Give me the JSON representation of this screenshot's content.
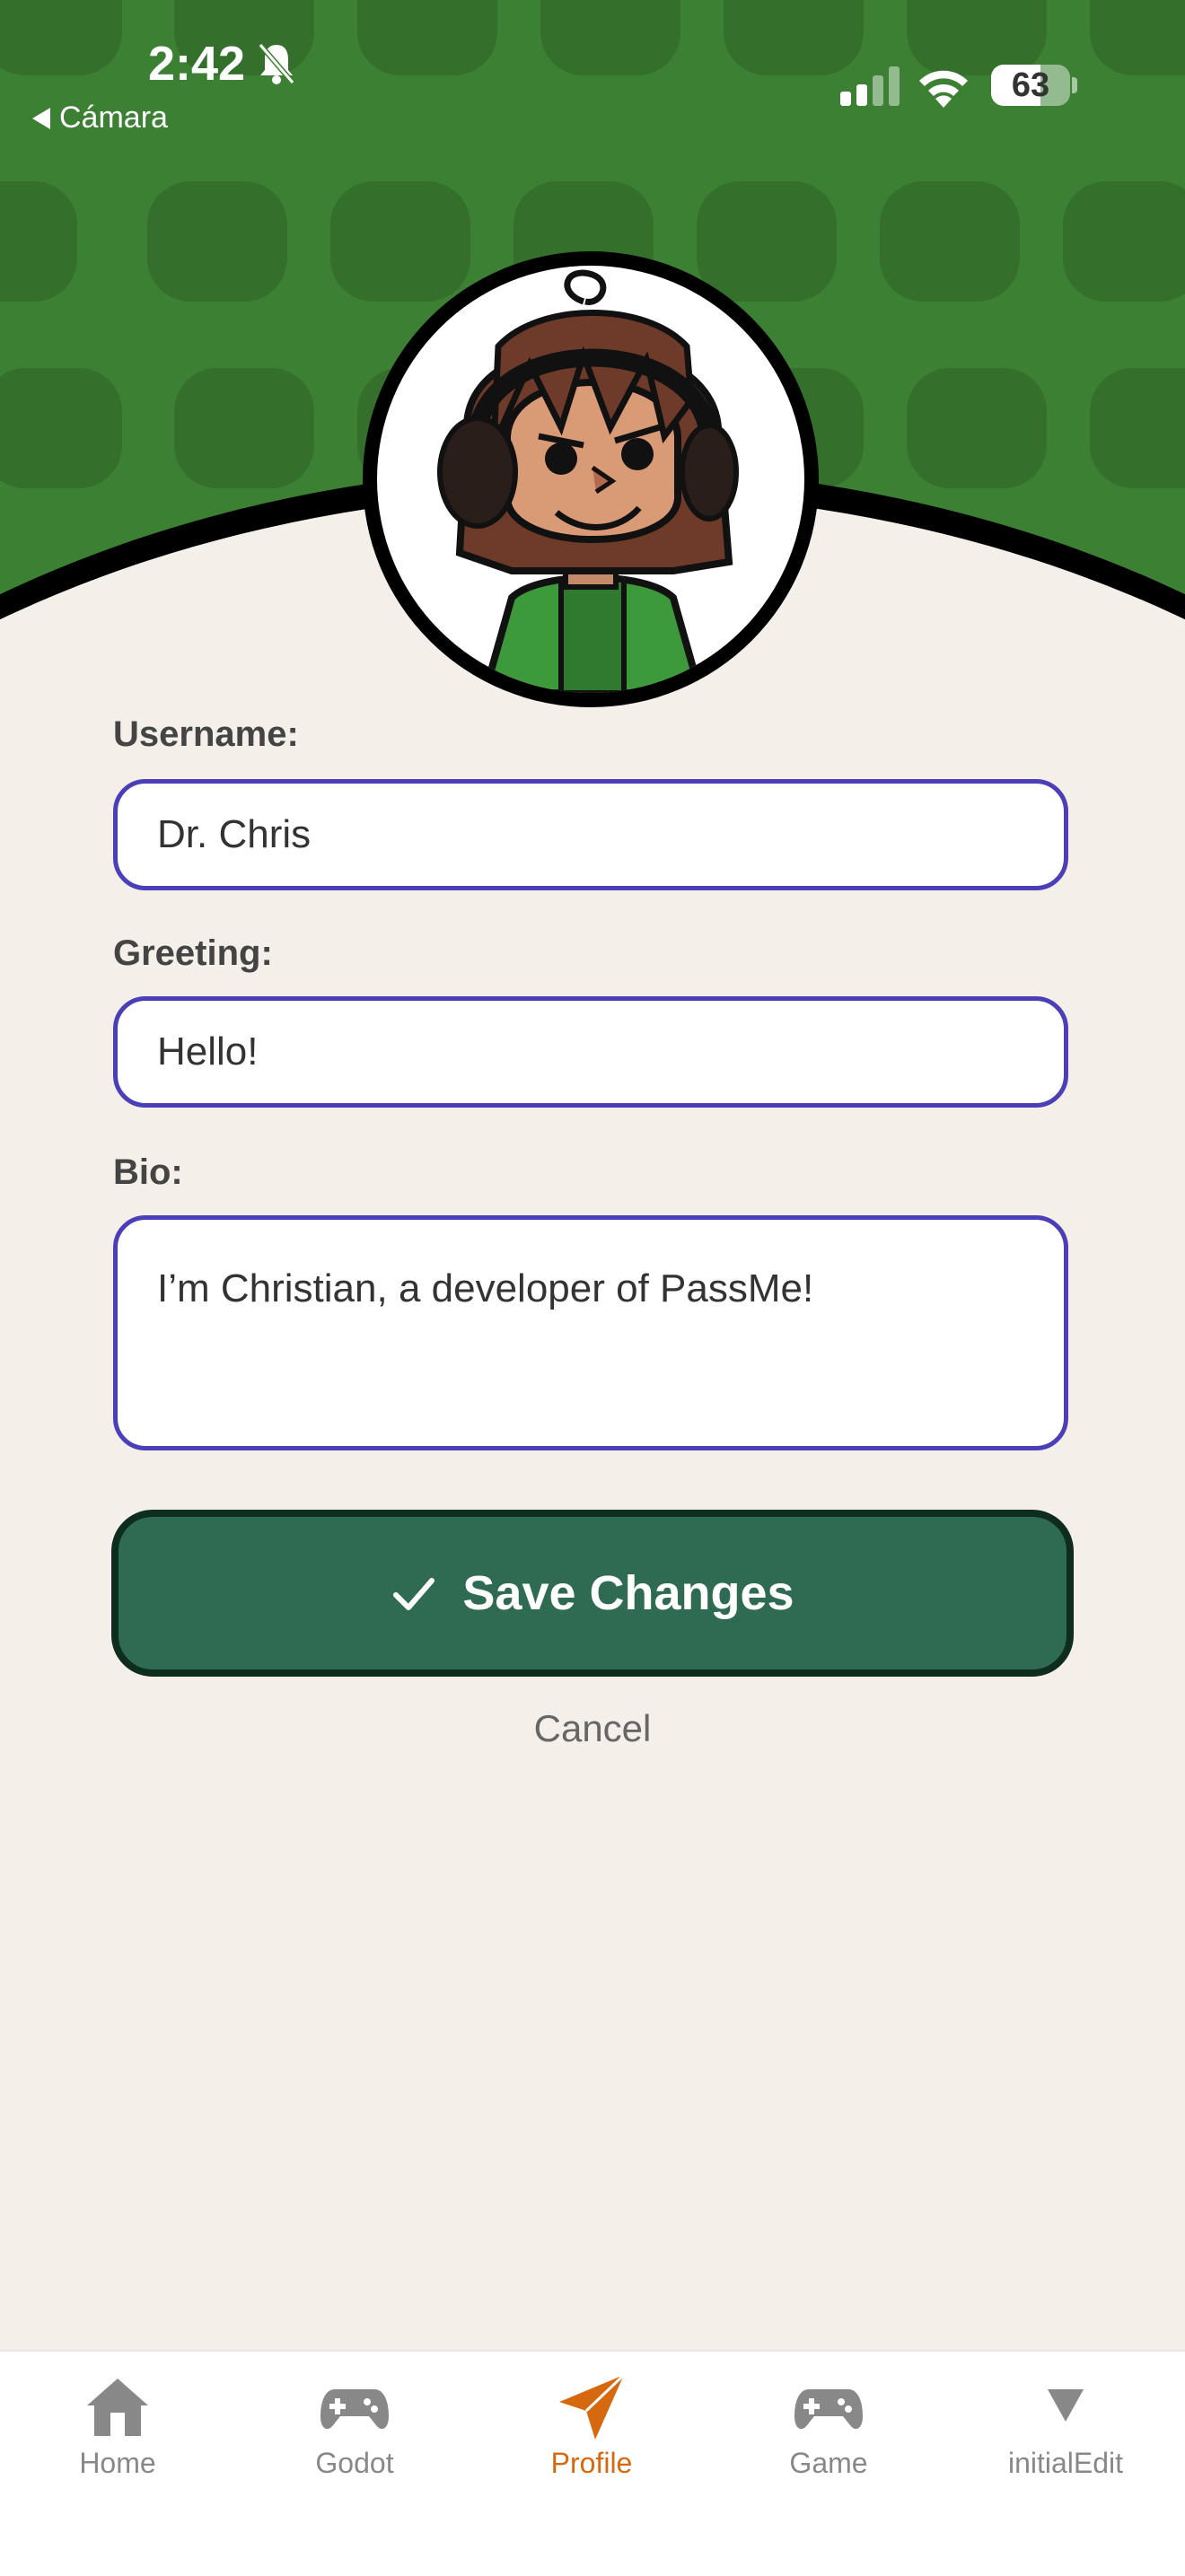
{
  "status_bar": {
    "time": "2:42",
    "back_label": "Cámara",
    "battery": "63",
    "battery_level": 0.63
  },
  "form": {
    "username": {
      "label": "Username:",
      "value": "Dr. Chris"
    },
    "greeting": {
      "label": "Greeting:",
      "value": "Hello!"
    },
    "bio": {
      "label": "Bio:",
      "value": "I’m Christian, a developer of PassMe!"
    },
    "save_label": "Save Changes",
    "cancel_label": "Cancel"
  },
  "tabs": [
    {
      "label": "Home",
      "icon": "home-icon",
      "active": false
    },
    {
      "label": "Godot",
      "icon": "gamepad-icon",
      "active": false
    },
    {
      "label": "Profile",
      "icon": "paper-plane-icon",
      "active": true
    },
    {
      "label": "Game",
      "icon": "gamepad-icon",
      "active": false
    },
    {
      "label": "initialEdit",
      "icon": "triangle-down-icon",
      "active": false
    }
  ],
  "colors": {
    "header_green": "#3c8133",
    "field_border": "#4a3fb8",
    "save_button": "#2e6b52",
    "active_tab": "#d6690f",
    "background": "#f4f0e9"
  }
}
